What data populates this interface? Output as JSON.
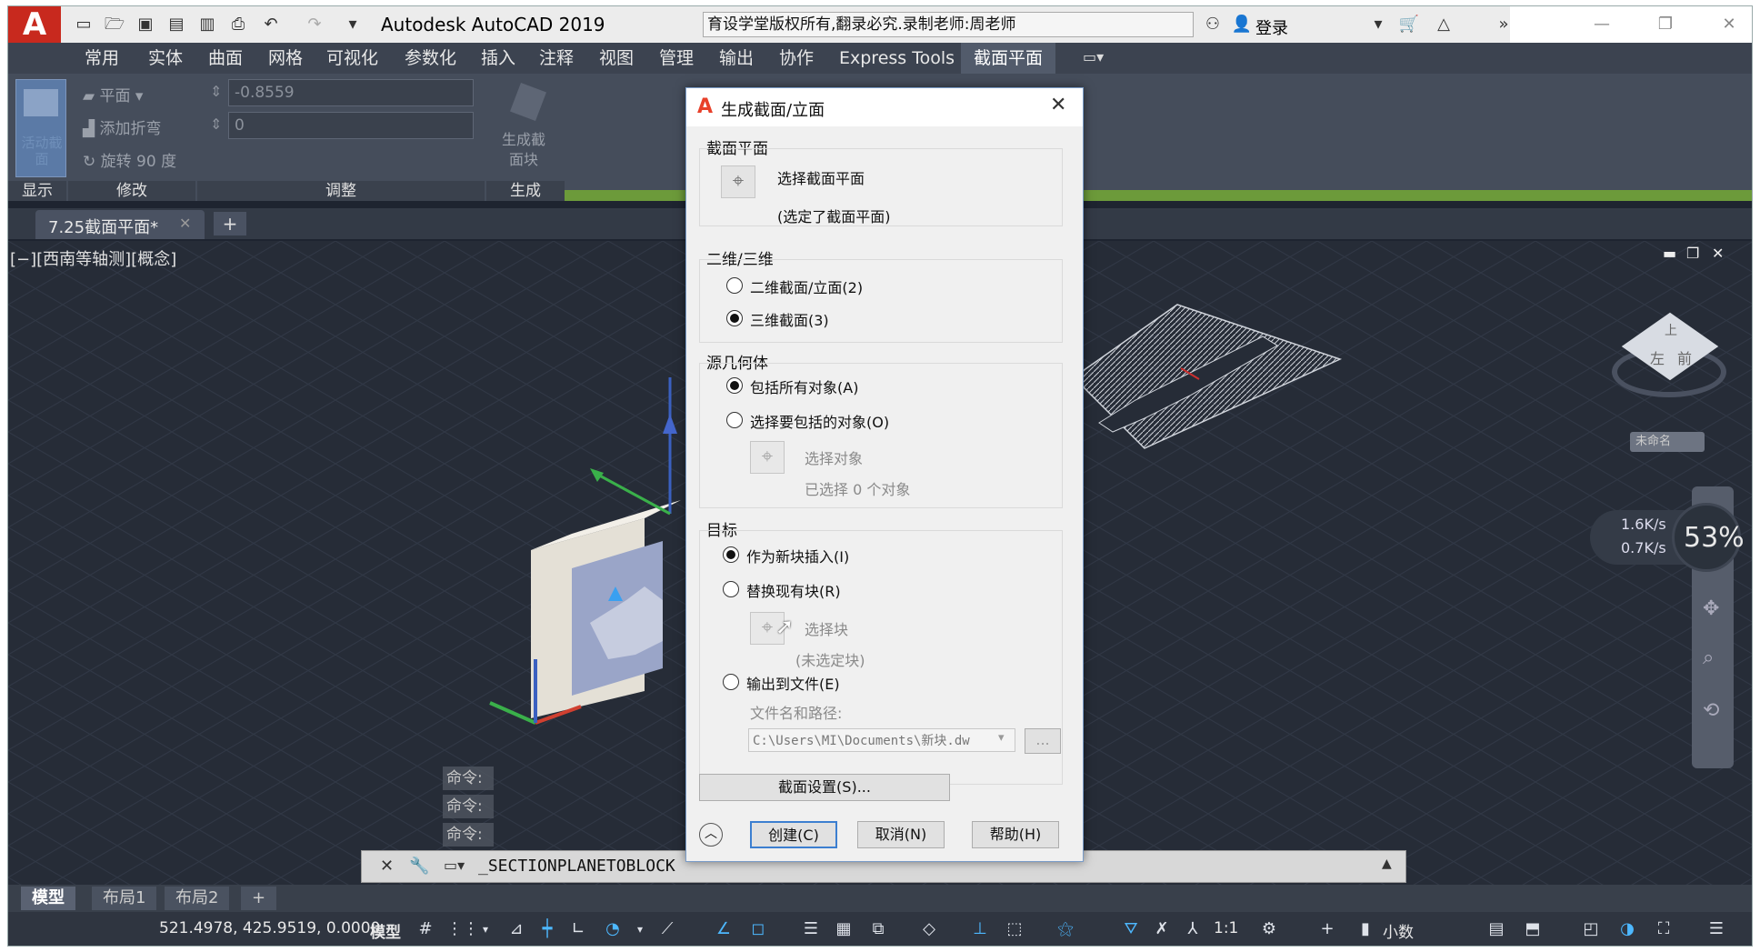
{
  "app": {
    "title": "Autodesk AutoCAD 2019",
    "search_text": "育设学堂版权所有,翻录必究.录制老师:周老师",
    "login_label": "登录",
    "logo_letter": "A"
  },
  "ribbon_tabs": [
    {
      "label": "常用"
    },
    {
      "label": "实体"
    },
    {
      "label": "曲面"
    },
    {
      "label": "网格"
    },
    {
      "label": "可视化"
    },
    {
      "label": "参数化"
    },
    {
      "label": "插入"
    },
    {
      "label": "注释"
    },
    {
      "label": "视图"
    },
    {
      "label": "管理"
    },
    {
      "label": "输出"
    },
    {
      "label": "协作"
    },
    {
      "label": "Express Tools"
    },
    {
      "label": "截面平面"
    }
  ],
  "ribbon": {
    "live_section_label": "活动截面",
    "plane_label": "平面",
    "add_jog_label": "添加折弯",
    "rotate_label": "旋转 90 度",
    "offset_value": "-0.8559",
    "slice_value": "0",
    "generate_block_label": "生成截面块",
    "panels": {
      "display": "显示",
      "modify": "修改",
      "adjust": "调整",
      "generate": "生成"
    }
  },
  "doc_tab": {
    "label": "7.25截面平面*"
  },
  "viewport": {
    "label": "[−][西南等轴测][概念]",
    "viewcube": {
      "top": "上",
      "left": "左",
      "front": "前",
      "named": "未命名"
    },
    "net": {
      "up": "1.6K/s",
      "down": "0.7K/s",
      "percent": "53%"
    }
  },
  "dialog": {
    "title": "生成截面/立面",
    "section_plane_group": "截面平面",
    "select_plane": "选择截面平面",
    "plane_selected": "(选定了截面平面)",
    "dim_group": "二维/三维",
    "opt_2d": "二维截面/立面(2)",
    "opt_3d": "三维截面(3)",
    "source_group": "源几何体",
    "include_all": "包括所有对象(A)",
    "select_objects_opt": "选择要包括的对象(O)",
    "select_objects": "选择对象",
    "selected_count": "已选择 0 个对象",
    "dest_group": "目标",
    "insert_new": "作为新块插入(I)",
    "replace_block": "替换现有块(R)",
    "select_block": "选择块",
    "no_block": "(未选定块)",
    "export_file": "输出到文件(E)",
    "file_path_label": "文件名和路径:",
    "file_path": "C:\\Users\\MI\\Documents\\新块.dw",
    "browse": "...",
    "section_settings": "截面设置(S)...",
    "create": "创建(C)",
    "cancel": "取消(N)",
    "help": "帮助(H)"
  },
  "command": {
    "history": [
      "命令:",
      "命令:",
      "命令:"
    ],
    "current": "_SECTIONPLANETOBLOCK"
  },
  "layout_tabs": [
    {
      "label": "模型"
    },
    {
      "label": "布局1"
    },
    {
      "label": "布局2"
    }
  ],
  "status": {
    "coords": "521.4978, 425.9519, 0.0000",
    "model": "模型",
    "scale": "1:1",
    "units": "小数"
  },
  "colors": {
    "accent": "#e8402a",
    "ribbon_green": "#6c9a3a",
    "viewport": "#262c37"
  }
}
